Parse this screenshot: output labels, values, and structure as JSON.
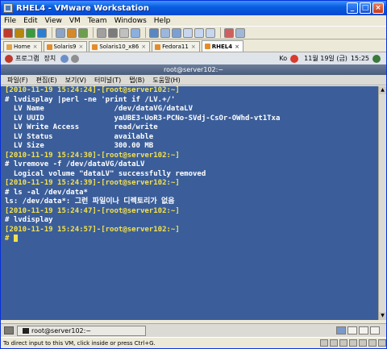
{
  "window": {
    "title": "RHEL4 - VMware Workstation"
  },
  "menu": [
    "File",
    "Edit",
    "View",
    "VM",
    "Team",
    "Windows",
    "Help"
  ],
  "tabs": [
    {
      "label": "Home",
      "active": false
    },
    {
      "label": "Solaris9",
      "active": false
    },
    {
      "label": "Solaris10_x86",
      "active": false
    },
    {
      "label": "Fedora11",
      "active": false
    },
    {
      "label": "RHEL4",
      "active": true
    }
  ],
  "guestbar": {
    "programs": "프로그램",
    "places": "장치",
    "ime": "Ko",
    "date": "11월 19일 (금)",
    "time": "15:25"
  },
  "terminal": {
    "window_title": "root@server102:~",
    "menus": [
      "파일(F)",
      "편집(E)",
      "보기(V)",
      "터미널(T)",
      "탭(B)",
      "도움말(H)"
    ],
    "lines": [
      {
        "segments": [
          {
            "t": "[2010-11-19 15:24:24]-[",
            "c": "y"
          },
          {
            "t": "root@server102:~",
            "c": "y"
          },
          {
            "t": "]",
            "c": "y"
          }
        ]
      },
      {
        "segments": [
          {
            "t": "# lvdisplay |perl -ne 'print if /LV.+/'",
            "c": "w"
          }
        ]
      },
      {
        "segments": [
          {
            "t": "  LV Name                /dev/dataVG/dataLV",
            "c": "w"
          }
        ]
      },
      {
        "segments": [
          {
            "t": "  LV UUID                yaUBE3-UoR3-PCNo-SVdj-CsOr-OWhd-vt1Txa",
            "c": "w"
          }
        ]
      },
      {
        "segments": [
          {
            "t": "  LV Write Access        read/write",
            "c": "w"
          }
        ]
      },
      {
        "segments": [
          {
            "t": "  LV Status              available",
            "c": "w"
          }
        ]
      },
      {
        "segments": [
          {
            "t": "  LV Size                300.00 MB",
            "c": "w"
          }
        ]
      },
      {
        "segments": [
          {
            "t": "[2010-11-19 15:24:30]-[",
            "c": "y"
          },
          {
            "t": "root@server102:~",
            "c": "y"
          },
          {
            "t": "]",
            "c": "y"
          }
        ]
      },
      {
        "segments": [
          {
            "t": "# lvremove -f /dev/dataVG/dataLV",
            "c": "w"
          }
        ]
      },
      {
        "segments": [
          {
            "t": "  Logical volume \"dataLV\" successfully removed",
            "c": "w"
          }
        ]
      },
      {
        "segments": [
          {
            "t": "[2010-11-19 15:24:39]-[",
            "c": "y"
          },
          {
            "t": "root@server102:~",
            "c": "y"
          },
          {
            "t": "]",
            "c": "y"
          }
        ]
      },
      {
        "segments": [
          {
            "t": "# ls -al /dev/data*",
            "c": "w"
          }
        ]
      },
      {
        "segments": [
          {
            "t": "ls: /dev/data*: 그런 파일이나 디렉토리가 없음",
            "c": "w"
          }
        ]
      },
      {
        "segments": [
          {
            "t": "[2010-11-19 15:24:47]-[",
            "c": "y"
          },
          {
            "t": "root@server102:~",
            "c": "y"
          },
          {
            "t": "]",
            "c": "y"
          }
        ]
      },
      {
        "segments": [
          {
            "t": "# lvdisplay",
            "c": "w"
          }
        ]
      },
      {
        "segments": [
          {
            "t": "[2010-11-19 15:24:57]-[",
            "c": "y"
          },
          {
            "t": "root@server102:~",
            "c": "y"
          },
          {
            "t": "]",
            "c": "y"
          }
        ]
      },
      {
        "segments": [
          {
            "t": "# ",
            "c": "y"
          }
        ]
      }
    ]
  },
  "taskbar": {
    "task_label": "root@server102:~"
  },
  "status": {
    "text": "To direct input to this VM, click inside or press Ctrl+G."
  },
  "colors": {
    "terminal_bg": "#3b5e9a",
    "prompt": "#f5e14a",
    "titlebar": "#0a5fe0"
  }
}
